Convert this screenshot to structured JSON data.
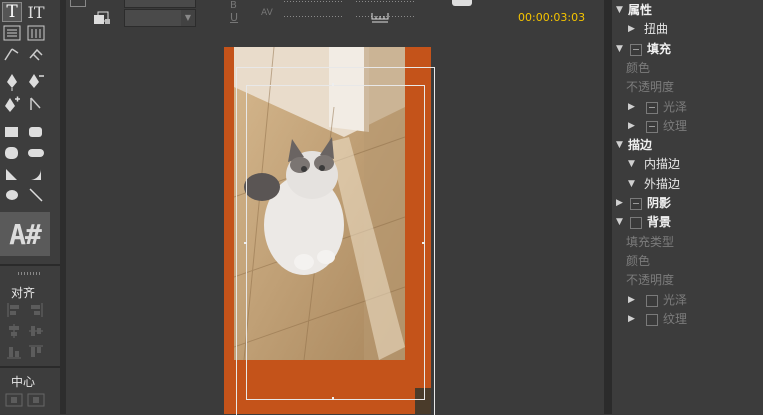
{
  "topbar": {
    "timecode": "00:00:03:03",
    "underline_icon": "U",
    "kerning_icon": "AV"
  },
  "toolbox": {
    "font_preview": "A#",
    "align_label": "对齐",
    "center_label": "中心"
  },
  "properties": {
    "rows": [
      {
        "label": "属性",
        "style": "b",
        "arrow": "▼",
        "indent": 1,
        "check": "none"
      },
      {
        "label": "扭曲",
        "style": "n",
        "arrow": "▶",
        "indent": 2,
        "check": "none"
      },
      {
        "label": "填充",
        "style": "b",
        "arrow": "▼",
        "indent": 1,
        "check": "bar"
      },
      {
        "label": "颜色",
        "style": "d",
        "arrow": "",
        "indent": 0,
        "check": "none"
      },
      {
        "label": "不透明度",
        "style": "d",
        "arrow": "",
        "indent": 0,
        "check": "none"
      },
      {
        "label": "光泽",
        "style": "d",
        "arrow": "▶",
        "indent": 2,
        "check": "bar"
      },
      {
        "label": "纹理",
        "style": "d",
        "arrow": "▶",
        "indent": 2,
        "check": "bar"
      },
      {
        "label": "描边",
        "style": "b",
        "arrow": "▼",
        "indent": 1,
        "check": "none"
      },
      {
        "label": "内描边",
        "style": "n",
        "arrow": "▼",
        "indent": 2,
        "check": "none"
      },
      {
        "label": "外描边",
        "style": "n",
        "arrow": "▼",
        "indent": 2,
        "check": "none"
      },
      {
        "label": "阴影",
        "style": "b",
        "arrow": "▶",
        "indent": 1,
        "check": "bar"
      },
      {
        "label": "背景",
        "style": "b",
        "arrow": "▼",
        "indent": 1,
        "check": "box"
      },
      {
        "label": "填充类型",
        "style": "d",
        "arrow": "",
        "indent": 0,
        "check": "none"
      },
      {
        "label": "颜色",
        "style": "d",
        "arrow": "",
        "indent": 0,
        "check": "none"
      },
      {
        "label": "不透明度",
        "style": "d",
        "arrow": "",
        "indent": 0,
        "check": "none"
      },
      {
        "label": "光泽",
        "style": "d",
        "arrow": "▶",
        "indent": 2,
        "check": "box"
      },
      {
        "label": "纹理",
        "style": "d",
        "arrow": "▶",
        "indent": 2,
        "check": "box"
      }
    ]
  },
  "colors": {
    "background_fill": "#c4531a",
    "timecode": "#f5c400",
    "panel": "#3c3c3c"
  }
}
